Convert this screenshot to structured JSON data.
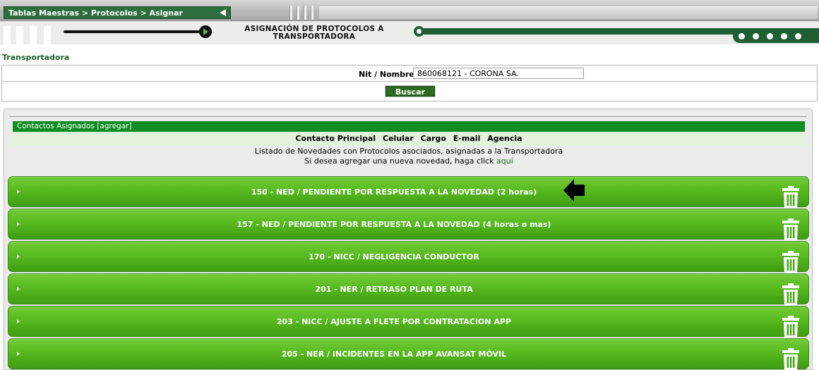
{
  "header": {
    "breadcrumb": "Tablas Maestras > Protocolos > Asignar",
    "banner_title_line1": "ASIGNACIÓN DE PROTOCOLOS A",
    "banner_title_line2": "TRANSPORTADORA"
  },
  "form": {
    "section_label": "Transportadora",
    "nit_label": "Nit / Nombre:",
    "nit_value": "860068121 - CORONA SA.",
    "search_button": "Buscar"
  },
  "contacts": {
    "header": "Contactos Asignados [agregar]",
    "columns": [
      "Contacto Principal",
      "Celular",
      "Cargo",
      "E-mail",
      "Agencia"
    ],
    "info_line1": "Listado de Novedades con Protocolos asociados, asignadas a la Transportadora",
    "info_line2_prefix": "Si desea agregar una nueva novedad, haga click",
    "info_line2_link": "aquí"
  },
  "novedades": [
    {
      "label": "150 - NED / PENDIENTE POR RESPUESTA A LA NOVEDAD (2 horas)"
    },
    {
      "label": "157 - NED / PENDIENTE POR RESPUESTA A LA NOVEDAD (4 horas o mas)"
    },
    {
      "label": "170 - NICC / NEGLIGENCIA CONDUCTOR"
    },
    {
      "label": "201 - NER / RETRASO PLAN DE RUTA"
    },
    {
      "label": "203 - NICC / AJUSTE A FLETE POR CONTRATACION APP"
    },
    {
      "label": "205 - NER / INCIDENTES EN LA APP AVANSAT MÓVIL"
    }
  ],
  "icons": {
    "row_expand": "caret-right-icon",
    "row_delete": "trash-icon",
    "pointer": "arrow-left-icon"
  },
  "colors": {
    "brand_dark_green": "#1f5f33",
    "row_green": "#5bbc22",
    "header_green": "#0f8c22"
  }
}
